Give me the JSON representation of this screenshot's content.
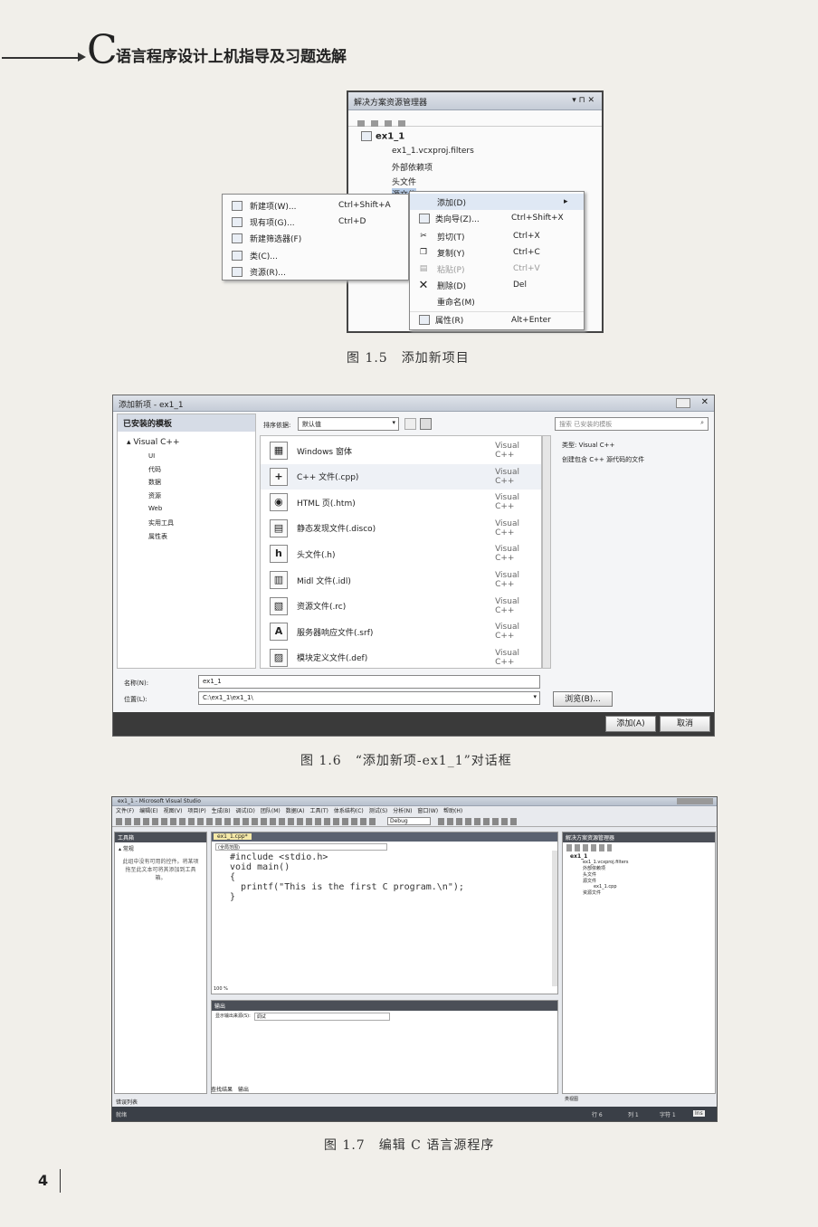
{
  "header": {
    "letter": "C",
    "title": "语言程序设计上机指导及习题选解"
  },
  "fig15": {
    "panel_title": "解决方案资源管理器",
    "panel_controls": "▾ ⊓ ✕",
    "project": "ex1_1",
    "tree": [
      "ex1_1.vcxproj.filters",
      "外部依赖项",
      "头文件",
      "源文件"
    ],
    "left_menu": [
      {
        "label": "新建项(W)...",
        "shortcut": "Ctrl+Shift+A"
      },
      {
        "label": "现有项(G)...",
        "shortcut": "Ctrl+D"
      },
      {
        "label": "新建筛选器(F)",
        "shortcut": ""
      },
      {
        "label": "类(C)...",
        "shortcut": ""
      },
      {
        "label": "资源(R)...",
        "shortcut": ""
      }
    ],
    "right_menu": [
      {
        "label": "添加(D)",
        "shortcut": "▸",
        "disabled": false
      },
      {
        "label": "类向导(Z)...",
        "shortcut": "Ctrl+Shift+X",
        "disabled": false
      },
      {
        "label": "剪切(T)",
        "shortcut": "Ctrl+X",
        "disabled": false
      },
      {
        "label": "复制(Y)",
        "shortcut": "Ctrl+C",
        "disabled": false
      },
      {
        "label": "粘贴(P)",
        "shortcut": "Ctrl+V",
        "disabled": true
      },
      {
        "label": "删除(D)",
        "shortcut": "Del",
        "disabled": false
      },
      {
        "label": "重命名(M)",
        "shortcut": "",
        "disabled": false
      },
      {
        "label": "属性(R)",
        "shortcut": "Alt+Enter",
        "disabled": false
      }
    ],
    "caption": "图 1.5　添加新项目"
  },
  "fig16": {
    "title": "添加新项 - ex1_1",
    "installed_templates": "已安装的模板",
    "tree_root": "Visual C++",
    "tree_children": [
      "UI",
      "代码",
      "数据",
      "资源",
      "Web",
      "实用工具",
      "属性表"
    ],
    "sort_label": "排序依据:",
    "sort_value": "默认值",
    "search_placeholder": "搜索 已安装的模板",
    "templates": [
      {
        "icon": "▦",
        "name": "Windows 窗体",
        "type": "Visual C++"
      },
      {
        "icon": "+",
        "name": "C++ 文件(.cpp)",
        "type": "Visual C++"
      },
      {
        "icon": "◉",
        "name": "HTML 页(.htm)",
        "type": "Visual C++"
      },
      {
        "icon": "▤",
        "name": "静态发现文件(.disco)",
        "type": "Visual C++"
      },
      {
        "icon": "h",
        "name": "头文件(.h)",
        "type": "Visual C++"
      },
      {
        "icon": "▥",
        "name": "Midl 文件(.idl)",
        "type": "Visual C++"
      },
      {
        "icon": "▧",
        "name": "资源文件(.rc)",
        "type": "Visual C++"
      },
      {
        "icon": "A",
        "name": "服务器响应文件(.srf)",
        "type": "Visual C++"
      },
      {
        "icon": "▨",
        "name": "模块定义文件(.def)",
        "type": "Visual C++"
      }
    ],
    "info_type_label": "类型: Visual C++",
    "info_desc": "创建包含 C++ 源代码的文件",
    "name_label": "名称(N):",
    "name_value": "ex1_1",
    "location_label": "位置(L):",
    "location_value": "C:\\ex1_1\\ex1_1\\",
    "browse": "浏览(B)...",
    "add": "添加(A)",
    "cancel": "取消",
    "caption": "图 1.6　“添加新项-ex1_1”对话框"
  },
  "fig17": {
    "title": "ex1_1 - Microsoft Visual Studio",
    "menu": [
      "文件(F)",
      "编辑(E)",
      "视图(V)",
      "项目(P)",
      "生成(B)",
      "调试(D)",
      "团队(M)",
      "数据(A)",
      "工具(T)",
      "体系结构(C)",
      "测试(S)",
      "分析(N)",
      "窗口(W)",
      "帮助(H)"
    ],
    "config": "Debug",
    "toolbox_title": "工具箱",
    "toolbox_group": "常规",
    "toolbox_msg": "此组中没有可用的控件。将某项拖至此文本可将其添加到工具箱。",
    "tab": "ex1_1.cpp*",
    "scope": "(全局范围)",
    "code": [
      "#include <stdio.h>",
      "void main()",
      "{",
      "  printf(\"This is the first C program.\\n\");",
      "}"
    ],
    "zoom": "100 %",
    "output_title": "输出",
    "output_label": "显示输出来源(S):",
    "output_value": "调试",
    "solution_title": "解决方案资源管理器",
    "sol_project": "ex1_1",
    "sol_tree": [
      "ex1_1.vcxproj.filters",
      "外部依赖项",
      "头文件",
      "源文件"
    ],
    "sol_file": "ex1_1.cpp",
    "sol_last": "资源文件",
    "bottom_tabs": [
      "查找结果",
      "输出"
    ],
    "status_left": "就绪",
    "status_items": [
      "行 6",
      "列 1",
      "字符 1"
    ],
    "status_right": "Ins",
    "task_label": "错误列表",
    "sol_tab": "类视图",
    "caption": "图 1.7　编辑 C 语言源程序"
  },
  "page_number": "4"
}
